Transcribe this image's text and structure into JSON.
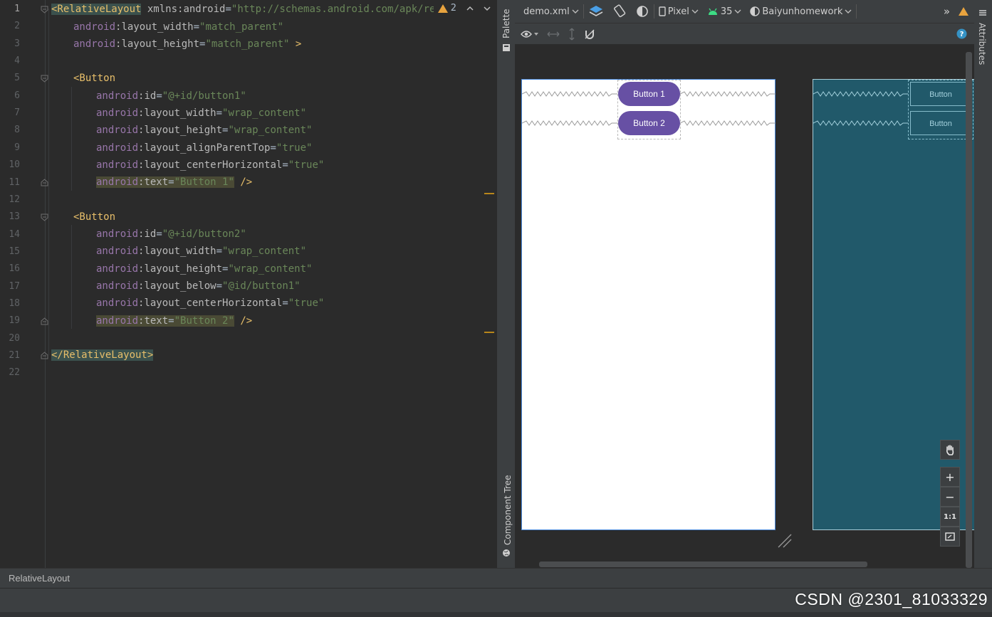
{
  "editor": {
    "line_numbers": [
      "1",
      "2",
      "3",
      "4",
      "5",
      "6",
      "7",
      "8",
      "9",
      "10",
      "11",
      "12",
      "13",
      "14",
      "15",
      "16",
      "17",
      "18",
      "19",
      "20",
      "21",
      "22"
    ],
    "lines": {
      "l1": {
        "tag": "<RelativeLayout",
        "sp": " ",
        "ns": "xmlns:android",
        "eq": "=",
        "val": "\"http://schemas.android.com/apk/res/a"
      },
      "l2": {
        "ns": "android",
        "attr": ":layout_width",
        "eq": "=",
        "val": "\"match_parent\""
      },
      "l3": {
        "ns": "android",
        "attr": ":layout_height",
        "eq": "=",
        "val": "\"match_parent\"",
        "end": " >"
      },
      "l5": {
        "tag": "<Button"
      },
      "l6": {
        "ns": "android",
        "attr": ":id",
        "eq": "=",
        "val": "\"@+id/button1\""
      },
      "l7": {
        "ns": "android",
        "attr": ":layout_width",
        "eq": "=",
        "val": "\"wrap_content\""
      },
      "l8": {
        "ns": "android",
        "attr": ":layout_height",
        "eq": "=",
        "val": "\"wrap_content\""
      },
      "l9": {
        "ns": "android",
        "attr": ":layout_alignParentTop",
        "eq": "=",
        "val": "\"true\""
      },
      "l10": {
        "ns": "android",
        "attr": ":layout_centerHorizontal",
        "eq": "=",
        "val": "\"true\""
      },
      "l11": {
        "ns": "android",
        "attr": ":text",
        "eq": "=",
        "val": "\"Button 1\"",
        "end": " />"
      },
      "l13": {
        "tag": "<Button"
      },
      "l14": {
        "ns": "android",
        "attr": ":id",
        "eq": "=",
        "val": "\"@+id/button2\""
      },
      "l15": {
        "ns": "android",
        "attr": ":layout_width",
        "eq": "=",
        "val": "\"wrap_content\""
      },
      "l16": {
        "ns": "android",
        "attr": ":layout_height",
        "eq": "=",
        "val": "\"wrap_content\""
      },
      "l17": {
        "ns": "android",
        "attr": ":layout_below",
        "eq": "=",
        "val": "\"@id/button1\""
      },
      "l18": {
        "ns": "android",
        "attr": ":layout_centerHorizontal",
        "eq": "=",
        "val": "\"true\""
      },
      "l19": {
        "ns": "android",
        "attr": ":text",
        "eq": "=",
        "val": "\"Button 2\"",
        "end": " />"
      },
      "l21": {
        "tag": "</RelativeLayout>"
      }
    },
    "warning_count": "2"
  },
  "side_tabs": {
    "palette": "Palette",
    "component_tree": "Component Tree",
    "attributes": "Attributes"
  },
  "design_toolbar": {
    "file": "demo.xml",
    "device": "Pixel",
    "api_level": "35",
    "theme": "Baiyunhomework",
    "overflow": "»"
  },
  "preview": {
    "button1": "Button 1",
    "button2": "Button 2",
    "blueprint_button1": "Button",
    "blueprint_button2": "Button"
  },
  "zoom": {
    "plus": "+",
    "minus": "−",
    "actual": "1:1"
  },
  "breadcrumb": "RelativeLayout",
  "watermark": "CSDN @2301_81033329",
  "colors": {
    "accent_button": "#6750a4",
    "blueprint": "#21596a",
    "warning": "#e8a33e"
  }
}
